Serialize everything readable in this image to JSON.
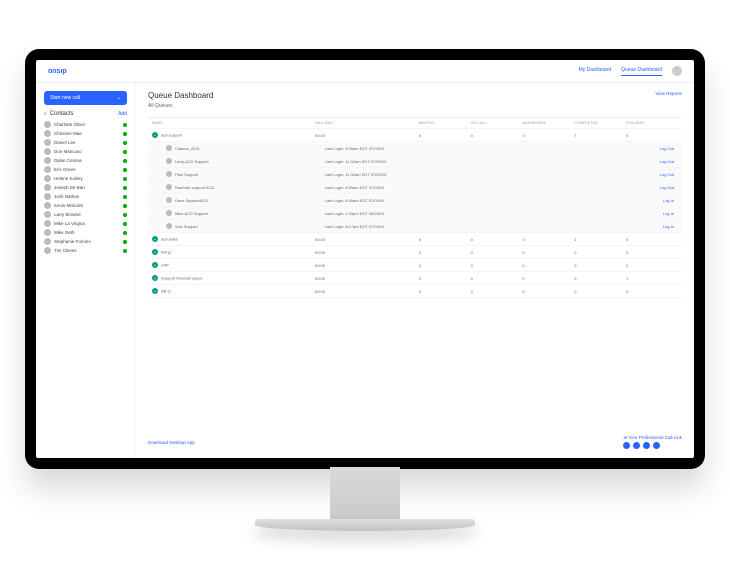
{
  "brand": "onsıp",
  "nav": {
    "my": "My Dashboard",
    "queue": "Queue Dashboard"
  },
  "sidebar": {
    "new_call": "Start new call",
    "contacts_label": "Contacts",
    "add": "Add",
    "contacts": [
      {
        "name": "Charlotte Oliver"
      },
      {
        "name": "Christine Mae"
      },
      {
        "name": "Daniel Lee"
      },
      {
        "name": "Don Mancuso"
      },
      {
        "name": "Dylan Cerena"
      },
      {
        "name": "Eric Green"
      },
      {
        "name": "Helene Kolsky"
      },
      {
        "name": "Joseph De Bari"
      },
      {
        "name": "Josh Nathan"
      },
      {
        "name": "Kevin Malcolm"
      },
      {
        "name": "Larry Browne"
      },
      {
        "name": "Mike La Virgina"
      },
      {
        "name": "Mike Oeth"
      },
      {
        "name": "Stephanie Fornino"
      },
      {
        "name": "Tim Cleves"
      }
    ]
  },
  "page": {
    "title": "Queue Dashboard",
    "subtitle": "All Queues",
    "view": "View Reports"
  },
  "cols": {
    "c1": "NAME",
    "c2": "MAX WAIT",
    "c3": "WAITING",
    "c4": "ON CALL",
    "c5": "ABANDONED",
    "c6": "COMPLETED",
    "c7": "FAILURES"
  },
  "queues": [
    {
      "name": "acd support",
      "wait": "00:00",
      "waiting": "0",
      "oncall": "0",
      "aban": "0",
      "comp": "7",
      "fail": "0",
      "expanded": true,
      "agents": [
        {
          "name": "Clarece_ACD",
          "login": "Last Login:  8:26am EDT 07/03/19",
          "action": "Log Out"
        },
        {
          "name": "Larry ACD Support",
          "login": "Last Login: 11:32am EDT 07/03/19",
          "action": "Log Out"
        },
        {
          "name": "Paul Support",
          "login": "Last Login: 11:32am EDT 07/03/19",
          "action": "Log Out"
        },
        {
          "name": "Rachelle support ACD",
          "login": "Last Login:  8:55am EDT 07/03/19",
          "action": "Log Out"
        },
        {
          "name": "Dave SupportACD",
          "login": "Last Login:  8:45am EDT 07/03/19",
          "action": "Log In"
        },
        {
          "name": "Mike ACD Support",
          "login": "Last Login:  1:33pm EDT 05/28/19",
          "action": "Log In"
        },
        {
          "name": "Voki Support",
          "login": "Last Login:  8:17am EDT 07/03/19",
          "action": "Log In"
        }
      ]
    },
    {
      "name": "acd sales",
      "wait": "00:00",
      "waiting": "0",
      "oncall": "0",
      "aban": "0",
      "comp": "1",
      "fail": "0"
    },
    {
      "name": "hiring",
      "wait": "00:00",
      "waiting": "0",
      "oncall": "0",
      "aban": "0",
      "comp": "0",
      "fail": "0"
    },
    {
      "name": "LNP",
      "wait": "00:00",
      "waiting": "0",
      "oncall": "0",
      "aban": "0",
      "comp": "0",
      "fail": "0"
    },
    {
      "name": "Support Holocall queue",
      "wait": "00:00",
      "waiting": "0",
      "oncall": "0",
      "aban": "0",
      "comp": "0",
      "fail": "1"
    },
    {
      "name": "AB Q",
      "wait": "00:00",
      "waiting": "0",
      "oncall": "0",
      "aban": "0",
      "comp": "0",
      "fail": "0"
    }
  ],
  "footer": {
    "download": "Download Desktop App",
    "tagline": "at Your Professional Call Link"
  }
}
